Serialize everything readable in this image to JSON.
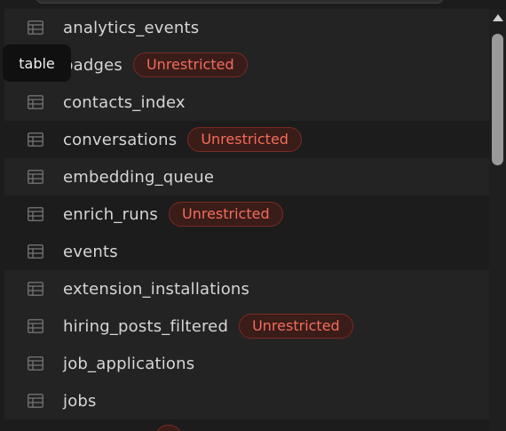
{
  "tooltip": {
    "text": "table"
  },
  "tables": [
    {
      "name": "analytics_events",
      "badge": ""
    },
    {
      "name": "badges",
      "badge": "Unrestricted"
    },
    {
      "name": "contacts_index",
      "badge": ""
    },
    {
      "name": "conversations",
      "badge": "Unrestricted"
    },
    {
      "name": "embedding_queue",
      "badge": ""
    },
    {
      "name": "enrich_runs",
      "badge": "Unrestricted"
    },
    {
      "name": "events",
      "badge": ""
    },
    {
      "name": "extension_installations",
      "badge": ""
    },
    {
      "name": "hiring_posts_filtered",
      "badge": "Unrestricted"
    },
    {
      "name": "job_applications",
      "badge": ""
    },
    {
      "name": "jobs",
      "badge": ""
    }
  ],
  "icons": {
    "row_icon": "table-icon",
    "scroll_up": "chevron-up-icon"
  },
  "colors": {
    "background": "#1c1c1c",
    "row_alt": "#232323",
    "badge_text": "#f26d5c",
    "badge_border": "#7a2a23",
    "badge_fill": "#3a1c19",
    "text": "#d6d6d6"
  }
}
